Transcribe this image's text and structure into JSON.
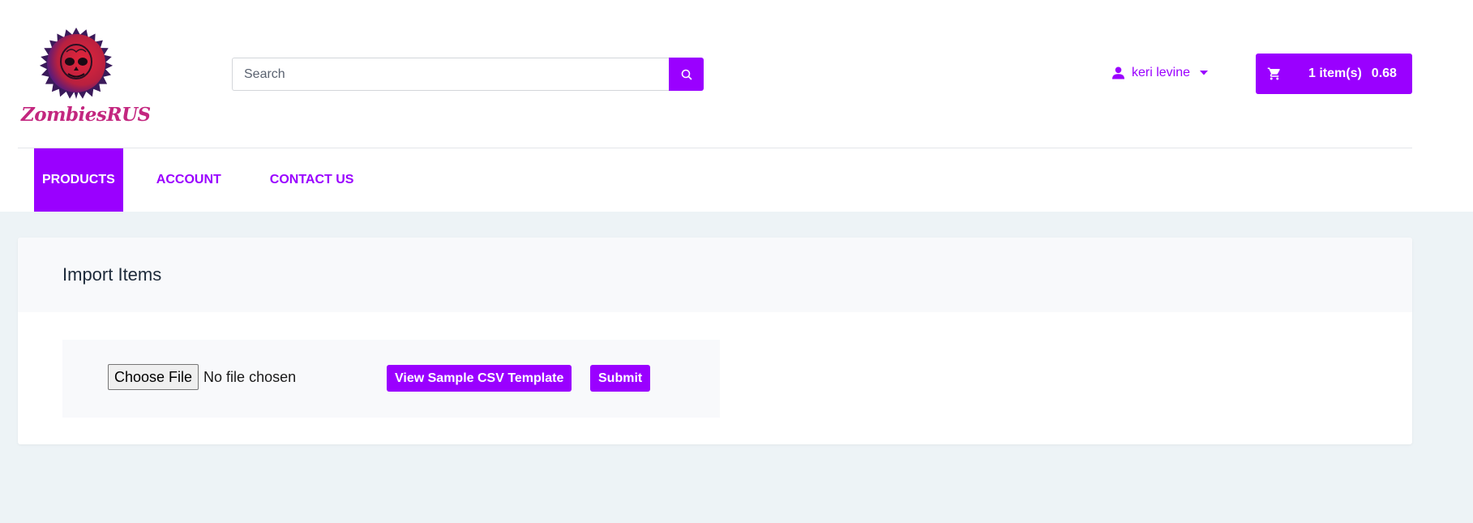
{
  "brand": {
    "logo_text": "ZombiesRUS",
    "colors": {
      "accent": "#9a00ff",
      "logo_text": "#c3267f",
      "page_bg": "#edf3f6"
    }
  },
  "search": {
    "placeholder": "Search",
    "value": "",
    "icon": "search-icon"
  },
  "user": {
    "name": "keri levine",
    "icon": "user-icon",
    "caret_icon": "caret-down-icon"
  },
  "cart": {
    "icon": "cart-icon",
    "count_label": "1 item(s)",
    "total": "0.68"
  },
  "nav": {
    "items": [
      {
        "label": "PRODUCTS",
        "active": true
      },
      {
        "label": "ACCOUNT",
        "active": false
      },
      {
        "label": "CONTACT US",
        "active": false
      }
    ]
  },
  "import": {
    "title": "Import Items",
    "choose_file_label": "Choose File",
    "file_status": "No file chosen",
    "sample_label": "View Sample CSV Template",
    "submit_label": "Submit"
  }
}
